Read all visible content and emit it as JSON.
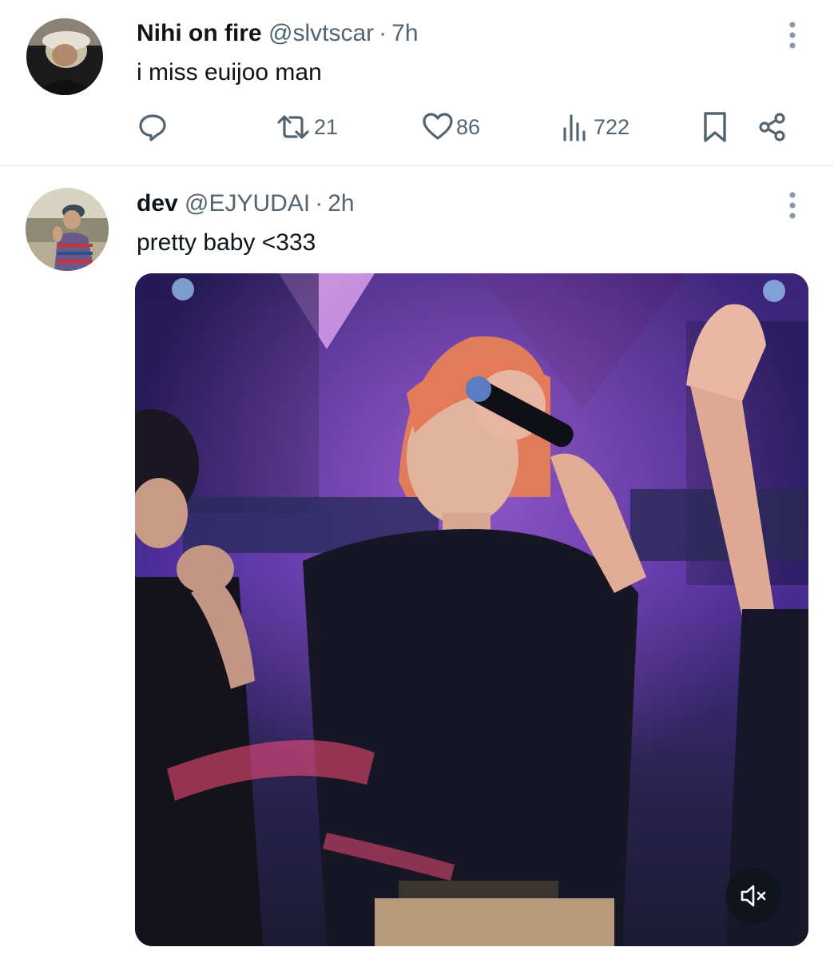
{
  "colors": {
    "text_primary": "#0f1419",
    "text_secondary": "#536471",
    "divider": "#e3e6e8",
    "mute_bg": "#0f1419"
  },
  "tweets": [
    {
      "name": "Nihi on fire",
      "handle": "@slvtscar",
      "separator": "·",
      "time": "7h",
      "text": "i miss euijoo man",
      "stats": {
        "replies": "",
        "retweets": "21",
        "likes": "86",
        "views": "722"
      },
      "icons": [
        "reply-icon",
        "retweet-icon",
        "like-icon",
        "views-icon",
        "bookmark-icon",
        "share-icon",
        "more-icon"
      ]
    },
    {
      "name": "dev",
      "handle": "@EJYUDAI",
      "separator": "·",
      "time": "2h",
      "text": "pretty baby <333",
      "media": {
        "type": "video",
        "muted": true,
        "icons": [
          "mute-icon"
        ]
      }
    }
  ]
}
